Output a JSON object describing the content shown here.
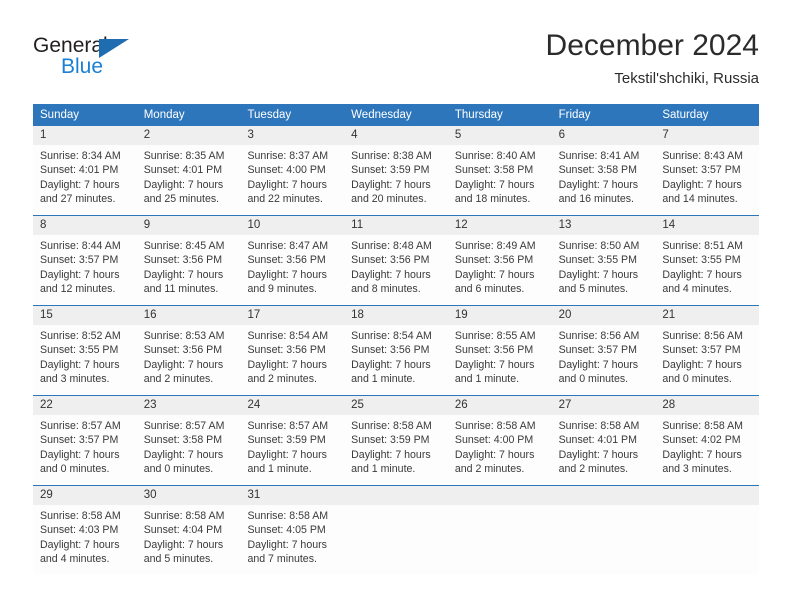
{
  "logo": {
    "word_one": "General",
    "word_two": "Blue",
    "triangle_icon": "blue-triangle-icon",
    "accent_dark": "#1f6cb0",
    "accent_light": "#1b7fd4"
  },
  "header": {
    "title": "December 2024",
    "subtitle": "Tekstil'shchiki, Russia"
  },
  "colors": {
    "header_blue": "#2e76bc",
    "row_band_gray": "#efefef",
    "cell_white": "#fdfdfd",
    "text_dark": "#3a3a3a"
  },
  "weekdays": [
    "Sunday",
    "Monday",
    "Tuesday",
    "Wednesday",
    "Thursday",
    "Friday",
    "Saturday"
  ],
  "weeks": [
    {
      "days": [
        {
          "num": "1",
          "sunrise": "Sunrise: 8:34 AM",
          "sunset": "Sunset: 4:01 PM",
          "daylight_l1": "Daylight: 7 hours",
          "daylight_l2": "and 27 minutes."
        },
        {
          "num": "2",
          "sunrise": "Sunrise: 8:35 AM",
          "sunset": "Sunset: 4:01 PM",
          "daylight_l1": "Daylight: 7 hours",
          "daylight_l2": "and 25 minutes."
        },
        {
          "num": "3",
          "sunrise": "Sunrise: 8:37 AM",
          "sunset": "Sunset: 4:00 PM",
          "daylight_l1": "Daylight: 7 hours",
          "daylight_l2": "and 22 minutes."
        },
        {
          "num": "4",
          "sunrise": "Sunrise: 8:38 AM",
          "sunset": "Sunset: 3:59 PM",
          "daylight_l1": "Daylight: 7 hours",
          "daylight_l2": "and 20 minutes."
        },
        {
          "num": "5",
          "sunrise": "Sunrise: 8:40 AM",
          "sunset": "Sunset: 3:58 PM",
          "daylight_l1": "Daylight: 7 hours",
          "daylight_l2": "and 18 minutes."
        },
        {
          "num": "6",
          "sunrise": "Sunrise: 8:41 AM",
          "sunset": "Sunset: 3:58 PM",
          "daylight_l1": "Daylight: 7 hours",
          "daylight_l2": "and 16 minutes."
        },
        {
          "num": "7",
          "sunrise": "Sunrise: 8:43 AM",
          "sunset": "Sunset: 3:57 PM",
          "daylight_l1": "Daylight: 7 hours",
          "daylight_l2": "and 14 minutes."
        }
      ]
    },
    {
      "days": [
        {
          "num": "8",
          "sunrise": "Sunrise: 8:44 AM",
          "sunset": "Sunset: 3:57 PM",
          "daylight_l1": "Daylight: 7 hours",
          "daylight_l2": "and 12 minutes."
        },
        {
          "num": "9",
          "sunrise": "Sunrise: 8:45 AM",
          "sunset": "Sunset: 3:56 PM",
          "daylight_l1": "Daylight: 7 hours",
          "daylight_l2": "and 11 minutes."
        },
        {
          "num": "10",
          "sunrise": "Sunrise: 8:47 AM",
          "sunset": "Sunset: 3:56 PM",
          "daylight_l1": "Daylight: 7 hours",
          "daylight_l2": "and 9 minutes."
        },
        {
          "num": "11",
          "sunrise": "Sunrise: 8:48 AM",
          "sunset": "Sunset: 3:56 PM",
          "daylight_l1": "Daylight: 7 hours",
          "daylight_l2": "and 8 minutes."
        },
        {
          "num": "12",
          "sunrise": "Sunrise: 8:49 AM",
          "sunset": "Sunset: 3:56 PM",
          "daylight_l1": "Daylight: 7 hours",
          "daylight_l2": "and 6 minutes."
        },
        {
          "num": "13",
          "sunrise": "Sunrise: 8:50 AM",
          "sunset": "Sunset: 3:55 PM",
          "daylight_l1": "Daylight: 7 hours",
          "daylight_l2": "and 5 minutes."
        },
        {
          "num": "14",
          "sunrise": "Sunrise: 8:51 AM",
          "sunset": "Sunset: 3:55 PM",
          "daylight_l1": "Daylight: 7 hours",
          "daylight_l2": "and 4 minutes."
        }
      ]
    },
    {
      "days": [
        {
          "num": "15",
          "sunrise": "Sunrise: 8:52 AM",
          "sunset": "Sunset: 3:55 PM",
          "daylight_l1": "Daylight: 7 hours",
          "daylight_l2": "and 3 minutes."
        },
        {
          "num": "16",
          "sunrise": "Sunrise: 8:53 AM",
          "sunset": "Sunset: 3:56 PM",
          "daylight_l1": "Daylight: 7 hours",
          "daylight_l2": "and 2 minutes."
        },
        {
          "num": "17",
          "sunrise": "Sunrise: 8:54 AM",
          "sunset": "Sunset: 3:56 PM",
          "daylight_l1": "Daylight: 7 hours",
          "daylight_l2": "and 2 minutes."
        },
        {
          "num": "18",
          "sunrise": "Sunrise: 8:54 AM",
          "sunset": "Sunset: 3:56 PM",
          "daylight_l1": "Daylight: 7 hours",
          "daylight_l2": "and 1 minute."
        },
        {
          "num": "19",
          "sunrise": "Sunrise: 8:55 AM",
          "sunset": "Sunset: 3:56 PM",
          "daylight_l1": "Daylight: 7 hours",
          "daylight_l2": "and 1 minute."
        },
        {
          "num": "20",
          "sunrise": "Sunrise: 8:56 AM",
          "sunset": "Sunset: 3:57 PM",
          "daylight_l1": "Daylight: 7 hours",
          "daylight_l2": "and 0 minutes."
        },
        {
          "num": "21",
          "sunrise": "Sunrise: 8:56 AM",
          "sunset": "Sunset: 3:57 PM",
          "daylight_l1": "Daylight: 7 hours",
          "daylight_l2": "and 0 minutes."
        }
      ]
    },
    {
      "days": [
        {
          "num": "22",
          "sunrise": "Sunrise: 8:57 AM",
          "sunset": "Sunset: 3:57 PM",
          "daylight_l1": "Daylight: 7 hours",
          "daylight_l2": "and 0 minutes."
        },
        {
          "num": "23",
          "sunrise": "Sunrise: 8:57 AM",
          "sunset": "Sunset: 3:58 PM",
          "daylight_l1": "Daylight: 7 hours",
          "daylight_l2": "and 0 minutes."
        },
        {
          "num": "24",
          "sunrise": "Sunrise: 8:57 AM",
          "sunset": "Sunset: 3:59 PM",
          "daylight_l1": "Daylight: 7 hours",
          "daylight_l2": "and 1 minute."
        },
        {
          "num": "25",
          "sunrise": "Sunrise: 8:58 AM",
          "sunset": "Sunset: 3:59 PM",
          "daylight_l1": "Daylight: 7 hours",
          "daylight_l2": "and 1 minute."
        },
        {
          "num": "26",
          "sunrise": "Sunrise: 8:58 AM",
          "sunset": "Sunset: 4:00 PM",
          "daylight_l1": "Daylight: 7 hours",
          "daylight_l2": "and 2 minutes."
        },
        {
          "num": "27",
          "sunrise": "Sunrise: 8:58 AM",
          "sunset": "Sunset: 4:01 PM",
          "daylight_l1": "Daylight: 7 hours",
          "daylight_l2": "and 2 minutes."
        },
        {
          "num": "28",
          "sunrise": "Sunrise: 8:58 AM",
          "sunset": "Sunset: 4:02 PM",
          "daylight_l1": "Daylight: 7 hours",
          "daylight_l2": "and 3 minutes."
        }
      ]
    },
    {
      "days": [
        {
          "num": "29",
          "sunrise": "Sunrise: 8:58 AM",
          "sunset": "Sunset: 4:03 PM",
          "daylight_l1": "Daylight: 7 hours",
          "daylight_l2": "and 4 minutes."
        },
        {
          "num": "30",
          "sunrise": "Sunrise: 8:58 AM",
          "sunset": "Sunset: 4:04 PM",
          "daylight_l1": "Daylight: 7 hours",
          "daylight_l2": "and 5 minutes."
        },
        {
          "num": "31",
          "sunrise": "Sunrise: 8:58 AM",
          "sunset": "Sunset: 4:05 PM",
          "daylight_l1": "Daylight: 7 hours",
          "daylight_l2": "and 7 minutes."
        },
        {
          "num": "",
          "sunrise": "",
          "sunset": "",
          "daylight_l1": "",
          "daylight_l2": ""
        },
        {
          "num": "",
          "sunrise": "",
          "sunset": "",
          "daylight_l1": "",
          "daylight_l2": ""
        },
        {
          "num": "",
          "sunrise": "",
          "sunset": "",
          "daylight_l1": "",
          "daylight_l2": ""
        },
        {
          "num": "",
          "sunrise": "",
          "sunset": "",
          "daylight_l1": "",
          "daylight_l2": ""
        }
      ]
    }
  ]
}
